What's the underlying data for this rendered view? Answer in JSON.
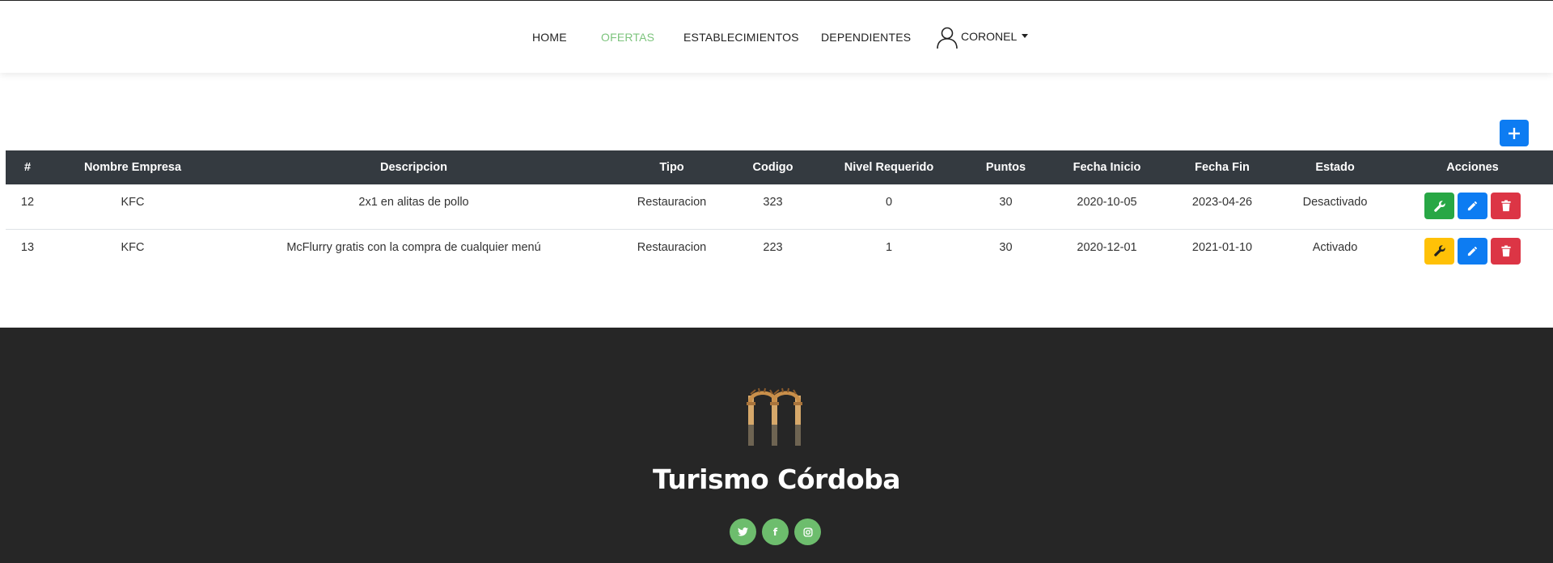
{
  "nav": {
    "items": [
      {
        "label": "HOME",
        "active": false
      },
      {
        "label": "OFERTAS",
        "active": true
      },
      {
        "label": "ESTABLECIMIENTOS",
        "active": false
      },
      {
        "label": "DEPENDIENTES",
        "active": false
      }
    ],
    "user": "CORONEL",
    "active_color": "#7dc47d"
  },
  "add_button": {
    "icon": "plus-icon"
  },
  "table": {
    "headers": [
      "#",
      "Nombre Empresa",
      "Descripcion",
      "Tipo",
      "Codigo",
      "Nivel Requerido",
      "Puntos",
      "Fecha Inicio",
      "Fecha Fin",
      "Estado",
      "Acciones"
    ],
    "rows": [
      {
        "id": "12",
        "empresa": "KFC",
        "descripcion": "2x1 en alitas de pollo",
        "tipo": "Restauracion",
        "codigo": "323",
        "nivel": "0",
        "puntos": "30",
        "inicio": "2020-10-05",
        "fin": "2023-04-26",
        "estado": "Desactivado",
        "toggle_color": "#28a745"
      },
      {
        "id": "13",
        "empresa": "KFC",
        "descripcion": "McFlurry gratis con la compra de cualquier menú",
        "tipo": "Restauracion",
        "codigo": "223",
        "nivel": "1",
        "puntos": "30",
        "inicio": "2020-12-01",
        "fin": "2021-01-10",
        "estado": "Activado",
        "toggle_color": "#ffc107"
      }
    ]
  },
  "footer": {
    "brand": "Turismo Córdoba",
    "social": [
      {
        "icon": "twitter-icon",
        "glyph": "🐦"
      },
      {
        "icon": "facebook-icon",
        "glyph": "f"
      },
      {
        "icon": "instagram-icon",
        "glyph": "◎"
      }
    ]
  }
}
